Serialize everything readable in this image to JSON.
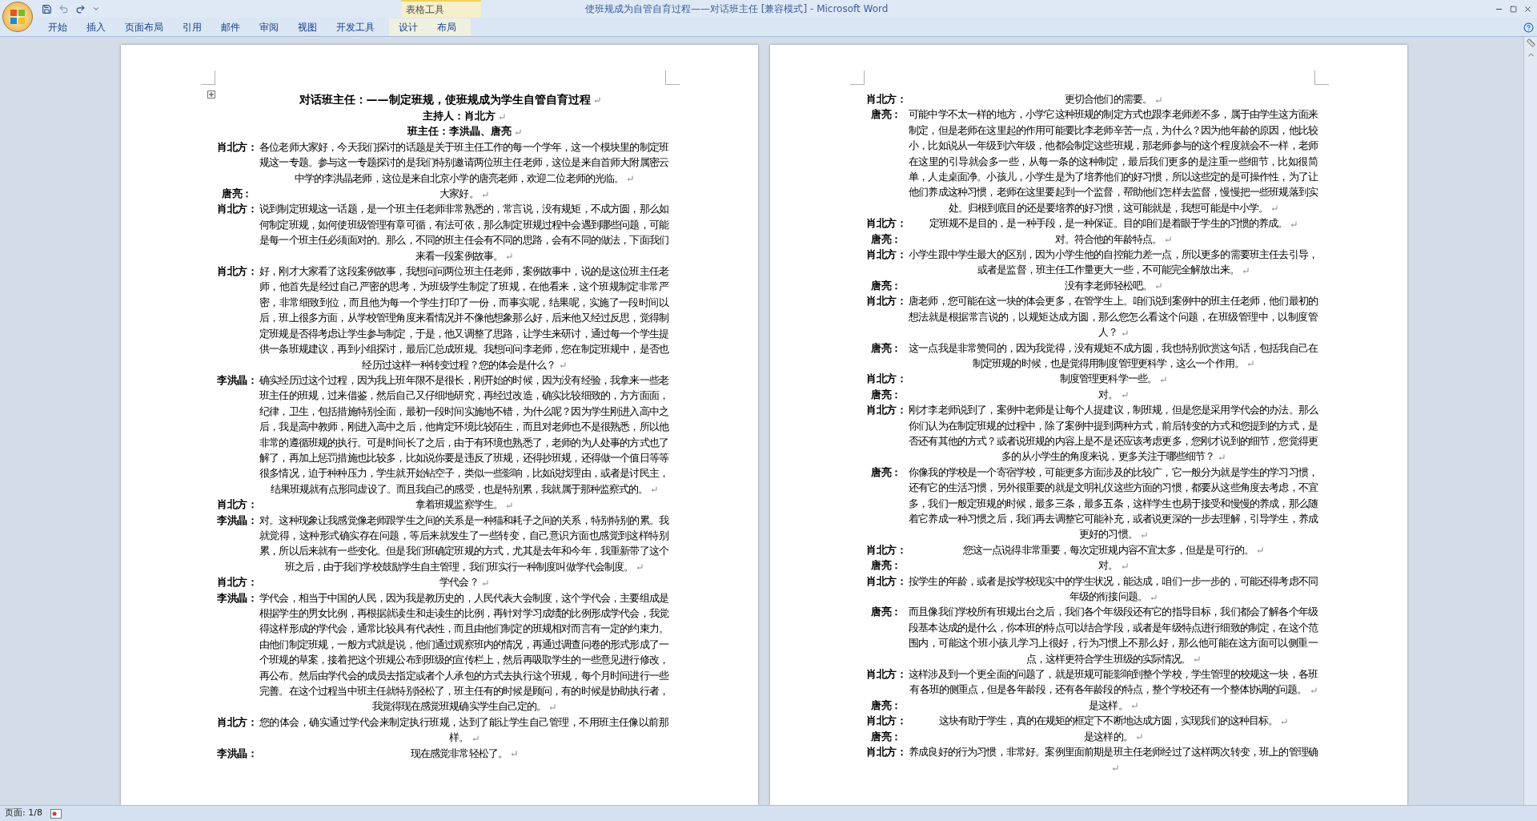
{
  "window": {
    "title": "使班规成为自管自育过程——对话班主任 [兼容模式] - Microsoft Word"
  },
  "ribbon": {
    "tabs": [
      {
        "label": "开始",
        "selected": false
      },
      {
        "label": "插入",
        "selected": false
      },
      {
        "label": "页面布局",
        "selected": false
      },
      {
        "label": "引用",
        "selected": false
      },
      {
        "label": "邮件",
        "selected": false
      },
      {
        "label": "审阅",
        "selected": false
      },
      {
        "label": "视图",
        "selected": false
      },
      {
        "label": "开发工具",
        "selected": false
      }
    ],
    "contextual_group": {
      "label": "表格工具",
      "tabs": [
        {
          "label": "设计",
          "selected": false
        },
        {
          "label": "布局",
          "selected": false
        }
      ]
    }
  },
  "document": {
    "formatting_marks": true,
    "pages": [
      {
        "title": "对话班主任：——制定班规，使班规成为学生自管自育过程",
        "subtitles": [
          "主持人：肖北方",
          "班主任：李洪晶、唐亮"
        ],
        "turns": [
          {
            "speaker": "肖北方：",
            "text": "各位老师大家好，今天我们探讨的话题是关于班主任工作的每一个学年，这一个模块里的制定班规这一专题。参与这一专题探讨的是我们特别邀请两位班主任老师，这位是来自首师大附属密云中学的李洪晶老师，这位是来自北京小学的唐亮老师，欢迎二位老师的光临。"
          },
          {
            "speaker": "唐亮：",
            "text": "大家好。"
          },
          {
            "speaker": "肖北方：",
            "text": "说到制定班规这一话题，是一个班主任老师非常熟悉的，常言说，没有规矩，不成方圆，那么如何制定班规，如何使班级管理有章可循，有法可依，那么制定班规过程中会遇到哪些问题，可能是每一个班主任必须面对的。那么，不同的班主任会有不同的思路，会有不同的做法，下面我们来看一段案例故事。"
          },
          {
            "speaker": "肖北方：",
            "text": "好，刚才大家看了这段案例故事，我想问问两位班主任老师，案例故事中，说的是这位班主任老师，他首先是经过自己严密的思考，为班级学生制定了班规，在他看来，这个班规制定非常严密，非常细致到位，而且他为每一个学生打印了一份，而事实呢，结果呢，实施了一段时间以后，班上很多方面，从学校管理角度来看情况并不像他想象那么好，后来他又经过反思，觉得制定班规是否得考虑让学生参与制定，于是，他又调整了思路，让学生来研讨，通过每一个学生提供一条班规建议，再到小组探讨，最后汇总成班规。我想问问李老师，您在制定班规中，是否也经历过这样一种转变过程？您的体会是什么？"
          },
          {
            "speaker": "李洪晶：",
            "text": "确实经历过这个过程，因为我上班年限不是很长，刚开始的时候，因为没有经验，我拿来一些老班主任的班规，过来借鉴，然后自己又仔细地研究，再经过改造，确实比较细致的，方方面面，纪律，卫生，包括措施特别全面，最初一段时间实施地不错，为什么呢？因为学生刚进入高中之后，我是高中教师，刚进入高中之后，他肯定环境比较陌生，而且对老师也不是很熟悉，所以他非常的遵循班规的执行。可是时间长了之后，由于有环境也熟悉了，老师的为人处事的方式也了解了，再加上惩罚措施也比较多，比如说你要是违反了班规，还得抄班规，还得做一个值日等等很多情况，迫于种种压力，学生就开始钻空子，类似一些影响，比如说找理由，或者是讨民主，结果班规就有点形同虚设了。而且我自己的感受，也是特别累，我就属于那种监察式的。"
          },
          {
            "speaker": "肖北方：",
            "text": "拿着班规监察学生。"
          },
          {
            "speaker": "李洪晶：",
            "text": "对。这种现象让我感觉像老师跟学生之间的关系是一种猫和耗子之间的关系，特别特别的累。我就觉得，这种形式确实存在问题，等后来就发生了一些转变，自己意识方面也感觉到这样特别累，所以后来就有一些变化。但是我们班确定班规的方式，尤其是去年和今年，我重新带了这个班之后，由于我们学校鼓励学生自主管理，我们班实行一种制度叫做学代会制度。"
          },
          {
            "speaker": "肖北方：",
            "text": "学代会？"
          },
          {
            "speaker": "李洪晶：",
            "text": "学代会，相当于中国的人民，因为我是教历史的，人民代表大会制度，这个学代会，主要组成是根据学生的男女比例，再根据就读生和走读生的比例，再针对学习成绩的比例形成学代会，我觉得这样形成的学代会，通常比较具有代表性，而且由他们制定的班规相对而言有一定的约束力。由他们制定班规，一般方式就是说，他们通过观察班内的情况，再通过调查问卷的形式形成了一个班规的草案，接着把这个班规公布到班级的宣传栏上，然后再吸取学生的一些意见进行修改，再公布。然后由学代会的成员去指定或者个人承包的方式去执行这个班规，每个月时间进行一些完善。在这个过程当中班主任就特别轻松了，班主任有的时候是顾问，有的时候是协助执行者，我觉得现在感觉班规确实学生自己定的。"
          },
          {
            "speaker": "肖北方：",
            "text": "您的体会，确实通过学代会来制定执行班规，达到了能让学生自己管理，不用班主任像以前那样。"
          },
          {
            "speaker": "李洪晶：",
            "text": "现在感觉非常轻松了。"
          }
        ]
      },
      {
        "turns": [
          {
            "speaker": "肖北方：",
            "text": "更切合他们的需要。"
          },
          {
            "speaker": "唐亮：",
            "text": "可能中学不太一样的地方，小学它这种班规的制定方式也跟李老师差不多，属于由学生这方面来制定，但是老师在这里起的作用可能要比李老师辛苦一点，为什么？因为他年龄的原因，他比较小，比如说从一年级到六年级，他都会制定这些班规，那老师参与的这个程度就会不一样，老师在这里的引导就会多一些，从每一条的这种制定，最后我们更多的是注重一些细节，比如很简单，人走桌面净。小孩儿，小学生是为了培养他们的好习惯，所以这些定的是可操作性，为了让他们养成这种习惯，老师在这里要起到一个监督，帮助他们怎样去监督，慢慢把一些班规落到实处。归根到底目的还是要培养的好习惯，这可能就是，我想可能是中小学。"
          },
          {
            "speaker": "肖北方：",
            "text": "定班规不是目的，是一种手段，是一种保证。目的咱们是着眼于学生的习惯的养成。"
          },
          {
            "speaker": "唐亮：",
            "text": "对。符合他的年龄特点。"
          },
          {
            "speaker": "肖北方：",
            "text": "小学生跟中学生最大的区别，因为小学生他的自控能力差一点，所以更多的需要班主任去引导，或者是监督，班主任工作量更大一些，不可能完全解放出来。"
          },
          {
            "speaker": "唐亮：",
            "text": "没有李老师轻松吧。"
          },
          {
            "speaker": "肖北方：",
            "text": "唐老师，您可能在这一块的体会更多，在管学生上。咱们说到案例中的班主任老师，他们最初的想法就是根据常言说的，以规矩达成方圆，那么您怎么看这个问题，在班级管理中，以制度管人？"
          },
          {
            "speaker": "唐亮：",
            "text": "这一点我是非常赞同的，因为我觉得，没有规矩不成方圆，我也特别欣赏这句话，包括我自己在制定班规的时候，也是觉得用制度管理更科学，这么一个作用。"
          },
          {
            "speaker": "肖北方：",
            "text": "制度管理更科学一些。"
          },
          {
            "speaker": "唐亮：",
            "text": "对。"
          },
          {
            "speaker": "肖北方：",
            "text": "刚才李老师说到了，案例中老师是让每个人提建议，制班规，但是您是采用学代会的办法。那么你们认为在制定班规的过程中，除了案例中提到两种方式，前后转变的方式和您提到的方式，是否还有其他的方式？或者说班规的内容上是不是还应该考虑更多，您刚才说到的细节，您觉得更多的从小学生的角度来说，更多关注于哪些细节？"
          },
          {
            "speaker": "唐亮：",
            "text": "你像我的学校是一个寄宿学校，可能更多方面涉及的比较广，它一般分为就是学生的学习习惯，还有它的生活习惯，另外很重要的就是文明礼仪这些方面的习惯，都要从这些角度去考虑，不宜多，我们一般定班规的时候，最多三条，最多五条，这样学生也易于接受和慢慢的养成，那么随着它养成一种习惯之后，我们再去调整它可能补充，或者说更深的一步去理解，引导学生，养成更好的习惯。"
          },
          {
            "speaker": "肖北方：",
            "text": "您这一点说得非常重要，每次定班规内容不宜太多，但是是可行的。"
          },
          {
            "speaker": "唐亮：",
            "text": "对。"
          },
          {
            "speaker": "肖北方：",
            "text": "按学生的年龄，或者是按学校现实中的学生状况，能达成，咱们一步一步的，可能还得考虑不同年级的衔接问题。"
          },
          {
            "speaker": "唐亮：",
            "text": "而且像我们学校所有班规出台之后，我们各个年级段还有它的指导目标，我们都会了解各个年级段基本达成的是什么，你本班的特点可以结合学段，或者是年级特点进行细致的制定，在这个范围内，可能这个班小孩儿学习上很好，行为习惯上不那么好，那么他可能在这方面可以侧重一点，这样更符合学生班级的实际情况。"
          },
          {
            "speaker": "肖北方：",
            "text": "这样涉及到一个更全面的问题了，就是班规可能影响到整个学校，学生管理的校规这一块，各班有各班的侧重点，但是各年龄段，还有各年龄段的特点，整个学校还有一个整体协调的问题。"
          },
          {
            "speaker": "唐亮：",
            "text": "是这样。"
          },
          {
            "speaker": "肖北方：",
            "text": "这块有助于学生，真的在规矩的框定下不断地达成方圆，实现我们的这种目标。"
          },
          {
            "speaker": "唐亮：",
            "text": "是这样的。"
          },
          {
            "speaker": "肖北方：",
            "text": "养成良好的行为习惯，非常好。案例里面前期是班主任老师经过了这样两次转变，班上的管理确"
          }
        ]
      }
    ]
  },
  "status_bar": {
    "page": "页面: 1/8"
  }
}
